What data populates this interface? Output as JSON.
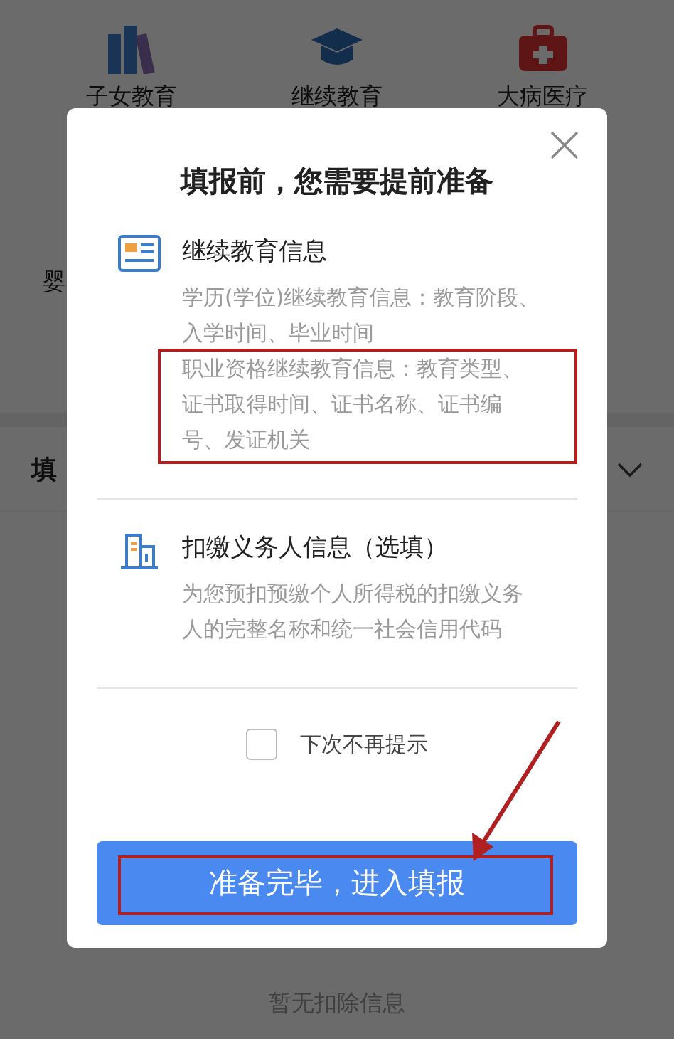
{
  "background": {
    "categories": [
      {
        "label": "子女教育",
        "kind": "books"
      },
      {
        "label": "继续教育",
        "kind": "cap"
      },
      {
        "label": "大病医疗",
        "kind": "kit"
      }
    ],
    "row_label": "婴",
    "section_title": "填",
    "section_expanded": false,
    "empty_text": "暂无扣除信息"
  },
  "dialog": {
    "title": "填报前，您需要提前准备",
    "items": [
      {
        "kind": "education",
        "title": "继续教育信息",
        "description": [
          {
            "text": "学历(学位)继续教育信息：教育阶段、入学时间、毕业时间",
            "highlighted": false
          },
          {
            "text": "职业资格继续教育信息：教育类型、证书取得时间、证书名称、证书编号、发证机关",
            "highlighted": true
          }
        ]
      },
      {
        "kind": "building",
        "title": "扣缴义务人信息（选填）",
        "description": [
          {
            "text": "为您预扣预缴个人所得税的扣缴义务人的完整名称和统一社会信用代码",
            "highlighted": false
          }
        ]
      }
    ],
    "checkbox": {
      "label": "下次不再提示",
      "checked": false
    },
    "button": {
      "label": "准备完毕，进入填报",
      "highlighted": true
    },
    "annotation_arrow": true
  }
}
